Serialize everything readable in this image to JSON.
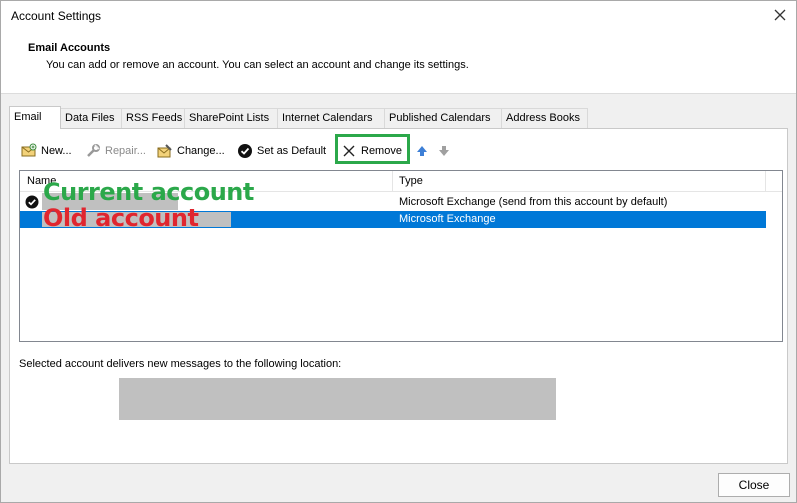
{
  "window": {
    "title": "Account Settings"
  },
  "header": {
    "title": "Email Accounts",
    "description": "You can add or remove an account. You can select an account and change its settings."
  },
  "tabs": [
    {
      "label": "Email",
      "active": true
    },
    {
      "label": "Data Files"
    },
    {
      "label": "RSS Feeds"
    },
    {
      "label": "SharePoint Lists"
    },
    {
      "label": "Internet Calendars"
    },
    {
      "label": "Published Calendars"
    },
    {
      "label": "Address Books"
    }
  ],
  "toolbar": {
    "new_label": "New...",
    "repair_label": "Repair...",
    "change_label": "Change...",
    "set_default_label": "Set as Default",
    "remove_label": "Remove"
  },
  "accounts": {
    "columns": {
      "name": "Name",
      "type": "Type"
    },
    "rows": [
      {
        "type": "Microsoft Exchange (send from this account by default)",
        "default": true,
        "selected": false
      },
      {
        "type": "Microsoft Exchange",
        "default": false,
        "selected": true
      }
    ]
  },
  "annotations": {
    "current": "Current account",
    "old": "Old account",
    "current_color": "#2ba84a",
    "old_color": "#e0262f",
    "highlight_color": "#2ba84a"
  },
  "delivery": {
    "label": "Selected account delivers new messages to the following location:"
  },
  "footer": {
    "close_label": "Close"
  },
  "colors": {
    "selection": "#0078d7",
    "redaction": "#c0c0c0"
  }
}
